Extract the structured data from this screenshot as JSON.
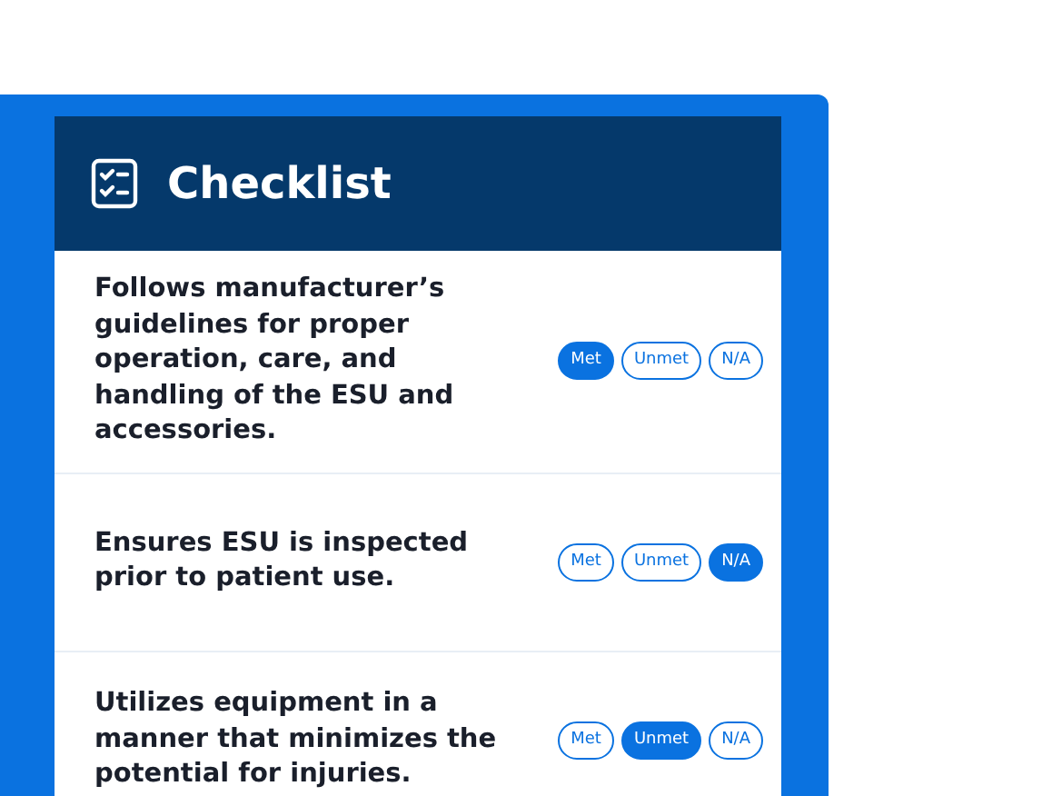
{
  "title": "Checklist",
  "items": [
    {
      "text": "Follows manufacturer’s guidelines for proper operation, care, and handling of the ESU and accessories.",
      "options": [
        {
          "label": "Met",
          "selected": true
        },
        {
          "label": "Unmet",
          "selected": false
        },
        {
          "label": "N/A",
          "selected": false
        }
      ]
    },
    {
      "text": "Ensures ESU is inspected prior to patient use.",
      "options": [
        {
          "label": "Met",
          "selected": false
        },
        {
          "label": "Unmet",
          "selected": false
        },
        {
          "label": "N/A",
          "selected": true
        }
      ]
    },
    {
      "text": "Utilizes equipment in a manner that minimizes the  potential for injuries.",
      "options": [
        {
          "label": "Met",
          "selected": false
        },
        {
          "label": "Unmet",
          "selected": true
        },
        {
          "label": "N/A",
          "selected": false
        }
      ]
    }
  ]
}
